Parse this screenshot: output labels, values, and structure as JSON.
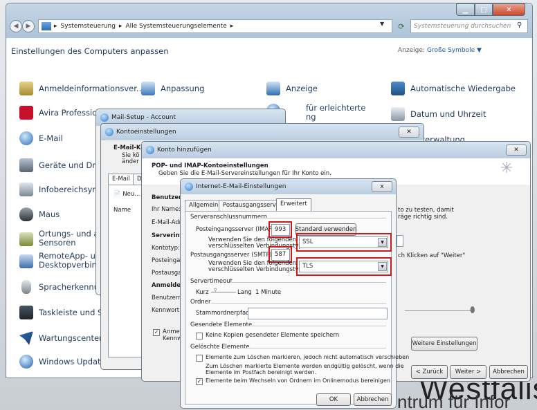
{
  "control_panel": {
    "breadcrumb": [
      "Systemsteuerung",
      "Alle Systemsteuerungselemente"
    ],
    "search_placeholder": "Systemsteuerung durchsuchen",
    "heading": "Einstellungen des Computers anpassen",
    "view_label": "Anzeige:",
    "view_value": "Große Symbole ▼",
    "items_col1": [
      "Anmeldeinformationsver...",
      "Avira Profession",
      "E-Mail",
      "Geräte und Druc",
      "Infobereichsymb",
      "Maus",
      "Ortungs- und ar",
      "Sensoren",
      "RemoteApp- und",
      "Desktopverbindu",
      "Spracherkennung",
      "Taskleiste und St",
      "Wartungscenter",
      "Windows Update"
    ],
    "items_col2": [
      "Anpassung"
    ],
    "items_col3": [
      "Anzeige",
      "für erleichterte",
      "ng"
    ],
    "items_col4": [
      "Automatische Wiedergabe",
      "Datum und Uhrzeit",
      "bverwaltung"
    ]
  },
  "mail_setup": {
    "title": "Mail-Setup - Account"
  },
  "account_settings": {
    "title": "Kontoeinstellungen",
    "heading": "E-Mail-Ko",
    "sub1": "Sie kö",
    "sub2": "änder",
    "tab_email": "E-Mail",
    "tab_data": "Da",
    "new_btn": "Neu...",
    "col_name": "Name"
  },
  "add_account": {
    "title": "Konto hinzufügen",
    "heading": "POP- und IMAP-Kontoeinstellungen",
    "subheading": "Geben Sie die E-Mail-Servereinstellungen für Ihr Konto ein.",
    "labels": [
      "Benutzerin",
      "Ihr Name:",
      "E-Mail-Adr",
      "Serverinfo",
      "Kontotyp:",
      "Posteingar",
      "Postausgar",
      "Anmeldein",
      "Benutzerna",
      "Kennwort:"
    ],
    "right_text1": "to zu testen, damit",
    "right_text2": "räge richtig sind.",
    "right_text3": "ch Klicken auf \"Weiter\"",
    "remember1": "Anmeld",
    "remember2": "Kennw",
    "more_settings": "Weitere Einstellungen",
    "back": "< Zurück",
    "next": "Weiter >",
    "cancel": "Abbrechen"
  },
  "internet_mail": {
    "title": "Internet-E-Mail-Einstellungen",
    "close_label": "x",
    "tabs": [
      "Allgemein",
      "Postausgangsserver",
      "Erweitert"
    ],
    "active_tab": "Erweitert",
    "server_ports": "Serveranschlussnummern",
    "imap_label": "Posteingangsserver (IMAP):",
    "imap_value": "993",
    "default_btn": "Standard verwenden",
    "encrypt_label1": "Verwenden Sie den folgenden",
    "encrypt_label2": "verschlüsselten Verbindungstyp:",
    "imap_encryption": "SSL",
    "smtp_label": "Postausgangsserver (SMTP):",
    "smtp_value": "587",
    "smtp_encryption": "TLS",
    "timeout_group": "Servertimeout",
    "timeout_short": "Kurz",
    "timeout_long": "Lang",
    "timeout_value": "1 Minute",
    "folders_group": "Ordner",
    "root_label": "Stammordnerpfad:",
    "sent_group": "Gesendete Elemente",
    "no_copies": "Keine Kopien gesendeter Elemente speichern",
    "deleted_group": "Gelöschte Elemente",
    "mark_delete": "Elemente zum Löschen markieren, jedoch nicht automatisch verschieben",
    "purge_info1": "Zum Löschen markierte Elemente werden endgültig gelöscht, wenn die",
    "purge_info2": "Elemente im Postfach bereinigt werden.",
    "purge_online": "Elemente beim Wechseln von Ordnern im Onlinemodus bereinigen",
    "ok": "OK",
    "cancel": "Abbrechen"
  },
  "background": {
    "line1": "Westfalis",
    "line2": "ntrum für Infor"
  },
  "colors": {
    "highlight": "#d01a1a",
    "link": "#1e395b"
  }
}
